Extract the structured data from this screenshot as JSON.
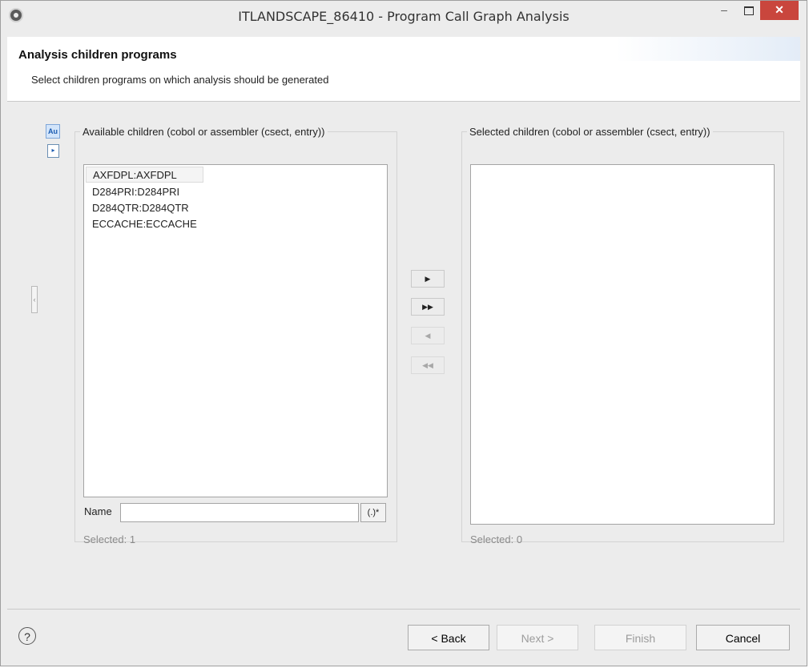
{
  "window": {
    "title": "ITLANDSCAPE_86410  -  Program Call Graph Analysis",
    "minimize_glyph": "–",
    "close_glyph": "✕"
  },
  "header": {
    "title": "Analysis children programs",
    "subtitle": "Select children programs on which analysis should be generated"
  },
  "side_tools": {
    "tool1_text": "Au"
  },
  "available": {
    "legend": "Available children (cobol or assembler (csect, entry))",
    "items": [
      "AXFDPL:AXFDPL",
      "D284PRI:D284PRI",
      "D284QTR:D284QTR",
      "ECCACHE:ECCACHE"
    ],
    "selected_item": "AXFDPL:AXFDPL",
    "name_label": "Name",
    "name_value": "",
    "regex_label": "(.)*",
    "selected_count": "Selected: 1"
  },
  "selected": {
    "legend": "Selected children (cobol or assembler (csect, entry))",
    "items": [],
    "selected_count": "Selected: 0"
  },
  "transfer_buttons": {
    "add_one": "▶",
    "add_all": "▶▶",
    "remove_one": "◀",
    "remove_all": "◀◀"
  },
  "footer": {
    "help": "?",
    "back": "< Back",
    "next": "Next >",
    "finish": "Finish",
    "cancel": "Cancel"
  }
}
